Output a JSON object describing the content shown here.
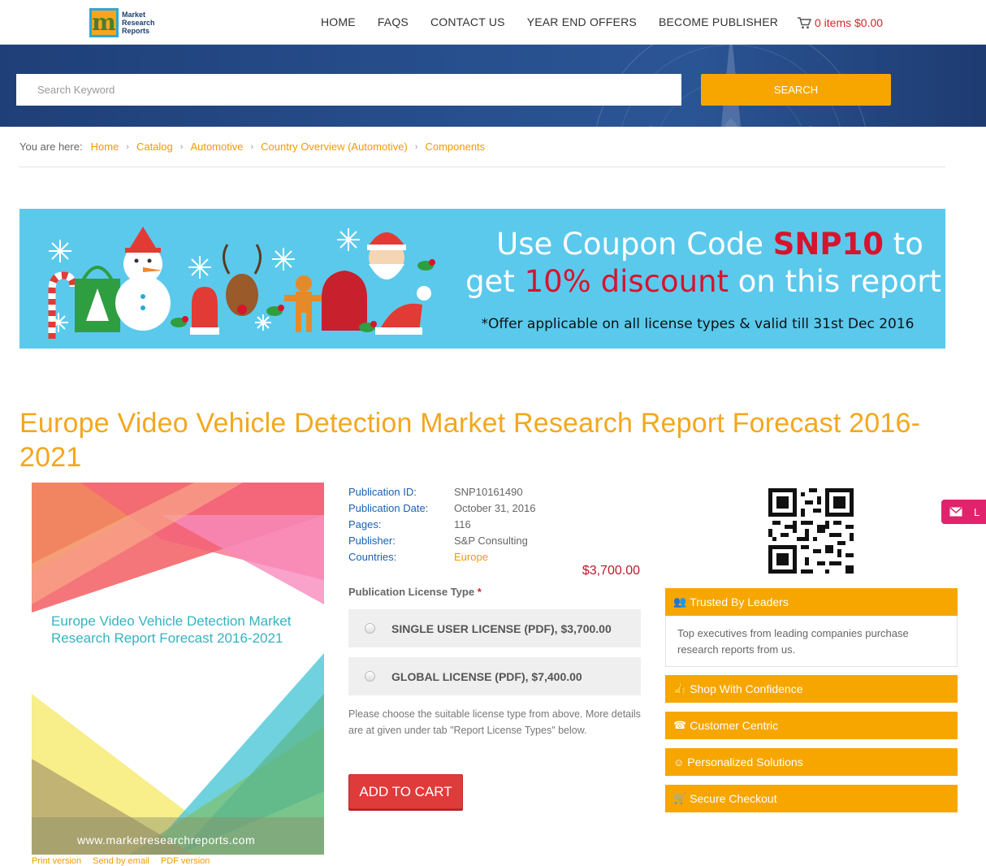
{
  "header": {
    "logo_text": "Market Research Reports",
    "nav": [
      "HOME",
      "FAQS",
      "CONTACT US",
      "YEAR END OFFERS",
      "BECOME PUBLISHER"
    ],
    "cart_label": "0 items $0.00"
  },
  "search": {
    "placeholder": "Search Keyword",
    "button_label": "SEARCH"
  },
  "breadcrumb": {
    "label": "You are here:",
    "items": [
      "Home",
      "Catalog",
      "Automotive",
      "Country Overview (Automotive)",
      "Components"
    ]
  },
  "banner": {
    "line1_a": "Use Coupon Code ",
    "line1_code": "SNP10",
    "line1_b": " to",
    "line2_a": "get ",
    "line2_discount": "10% discount",
    "line2_b": " on this report",
    "note": "*Offer applicable on all license types & valid till 31st Dec 2016"
  },
  "report": {
    "title": "Europe Video Vehicle Detection Market Research Report Forecast 2016-2021",
    "cover_title": "Europe Video Vehicle Detection Market Research Report Forecast 2016-2021",
    "cover_url": "www.marketresearchreports.com",
    "below_cover": [
      "Print version",
      "Send by email",
      "PDF version"
    ]
  },
  "meta": {
    "publication_id_label": "Publication ID:",
    "publication_id": "SNP10161490",
    "publication_date_label": "Publication Date:",
    "publication_date": "October 31, 2016",
    "pages_label": "Pages:",
    "pages": "116",
    "publisher_label": "Publisher:",
    "publisher": "S&P Consulting",
    "countries_label": "Countries:",
    "countries": "Europe"
  },
  "pricing": {
    "price": "$3,700.00",
    "license_type_label": "Publication License Type",
    "required_mark": "*",
    "options": [
      {
        "label": "SINGLE USER LICENSE (PDF), $3,700.00"
      },
      {
        "label": "GLOBAL LICENSE (PDF), $7,400.00"
      }
    ],
    "help_text": "Please choose the suitable license type from above. More details are at given under tab \"Report License Types\" below.",
    "add_to_cart": "ADD TO CART"
  },
  "sidebar": {
    "trusted_title": "Trusted By Leaders",
    "trusted_body": "Top executives from leading companies purchase research reports from us.",
    "items": [
      "Shop With Confidence",
      "Customer Centric",
      "Personalized Solutions",
      "Secure Checkout"
    ],
    "mail_tab": "L"
  },
  "colors": {
    "accent_orange": "#f7a600",
    "title_orange": "#f4a71d",
    "search_band": "#28508f",
    "banner_blue": "#5bc9ec",
    "price_red": "#b71b2a",
    "cart_button": "#e03b3b"
  }
}
